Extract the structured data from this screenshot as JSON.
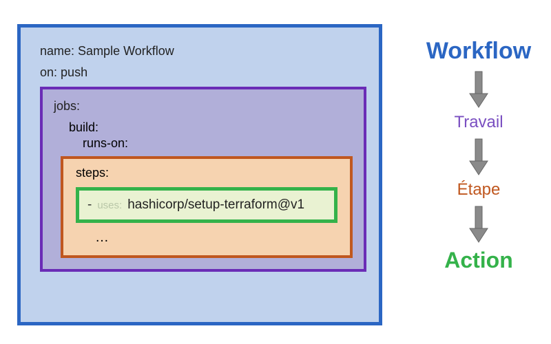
{
  "colors": {
    "workflow": "#2b66c3",
    "job": "#6a2cb6",
    "step": "#c0571f",
    "action": "#34b24a"
  },
  "yaml": {
    "name_key": "name:",
    "name_value": "Sample Workflow",
    "on_key": "on:",
    "on_value": "push",
    "jobs_label": "jobs:",
    "build_label": "build:",
    "runs_on_label": "runs-on:",
    "steps_label": "steps:",
    "dash": "-",
    "uses_key": "uses:",
    "action_ref": "hashicorp/setup-terraform@v1",
    "ellipsis": "…"
  },
  "legend": {
    "workflow": "Workflow",
    "job": "Travail",
    "step": "Étape",
    "action": "Action"
  }
}
